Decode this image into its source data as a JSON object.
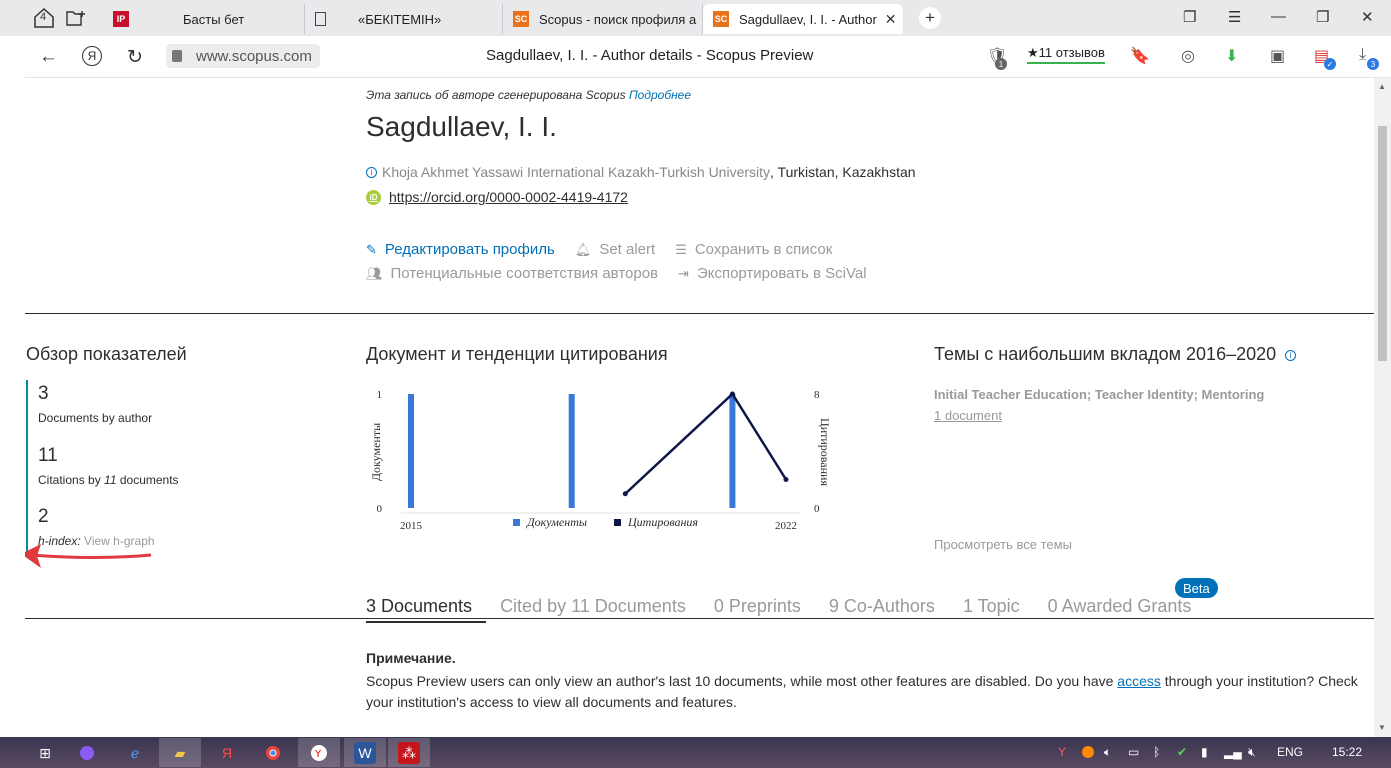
{
  "browser": {
    "tabs": [
      {
        "label": "",
        "icon": "tabs-count-icon"
      },
      {
        "label": "Басты бет",
        "icon": "ip-favicon"
      },
      {
        "label": "«БЕКІТЕМІН»",
        "icon": "document-favicon"
      },
      {
        "label": "Scopus - поиск профиля а",
        "icon": "scopus-favicon"
      },
      {
        "label": "Sagdullaev, I. I. - Author",
        "icon": "scopus-favicon",
        "active": true
      }
    ],
    "tabs_counter": "4",
    "url": "www.scopus.com",
    "page_title": "Sagdullaev, I. I. - Author details - Scopus Preview",
    "reviews_label": "★11 отзывов",
    "favicon_text": "SC",
    "badge_1": "1",
    "badge_3": "3"
  },
  "author": {
    "generated_note": "Эта запись об авторе сгенерирована Scopus",
    "generated_link": "Подробнее",
    "name": "Sagdullaev, I. I.",
    "affiliation": "Khoja Akhmet Yassawi International Kazakh-Turkish University",
    "location": ", Turkistan, Kazakhstan",
    "orcid": "https://orcid.org/0000-0002-4419-4172",
    "orcid_icon_text": "iD"
  },
  "actions": {
    "edit_profile": "Редактировать профиль",
    "set_alert": "Set alert",
    "save_to_list": "Сохранить в список",
    "potential_matches": "Потенциальные соответствия авторов",
    "export_scival": "Экспортировать в SciVal"
  },
  "metrics": {
    "title": "Обзор показателей",
    "documents_value": "3",
    "documents_label": "Documents by author",
    "citations_value": "11",
    "citations_label_pre": "Citations by",
    "citations_label_num": "11",
    "citations_label_post": "documents",
    "hindex_value": "2",
    "hindex_label": "h-index:",
    "hindex_link": "View h-graph"
  },
  "chart_section": {
    "title": "Документ и тенденции цитирования"
  },
  "chart_data": {
    "type": "bar",
    "x_start": 2015,
    "x_end": 2022,
    "x_tick_labels": [
      "2015",
      "2022"
    ],
    "series": [
      {
        "name": "Документы",
        "type": "bar",
        "axis": "left",
        "color": "#3a78d8",
        "points": [
          {
            "x": 2015,
            "y": 1
          },
          {
            "x": 2018,
            "y": 1
          },
          {
            "x": 2021,
            "y": 1
          }
        ]
      },
      {
        "name": "Цитирования",
        "type": "line",
        "axis": "right",
        "color": "#0f1747",
        "points": [
          {
            "x": 2019,
            "y": 1
          },
          {
            "x": 2021,
            "y": 8
          },
          {
            "x": 2022,
            "y": 2
          }
        ]
      }
    ],
    "ylabel_left": "Документы",
    "ylabel_right": "Цитирования",
    "ylim_left": [
      0,
      1
    ],
    "ylim_right": [
      0,
      8
    ],
    "y_left_ticks": [
      "0",
      "1"
    ],
    "y_right_ticks": [
      "0",
      "8"
    ],
    "legend_position": "bottom"
  },
  "topics": {
    "title": "Темы с наибольшим вкладом 2016–2020",
    "info_icon": "i",
    "topic_name": "Initial Teacher Education; Teacher Identity; Mentoring",
    "topic_docs": "1 document",
    "view_all": "Просмотреть все темы"
  },
  "doc_tabs": {
    "documents": "3 Documents",
    "cited_by": "Cited by 11 Documents",
    "preprints": "0 Preprints",
    "coauthors": "9 Co-Authors",
    "topic": "1 Topic",
    "grants": "0 Awarded Grants",
    "beta": "Beta"
  },
  "note": {
    "title": "Примечание.",
    "text_pre": "Scopus Preview users can only view an author's last 10 documents, while most other features are disabled. Do you have",
    "link": "access",
    "text_post": "through your institution? Check your institution's access to view all documents and features."
  },
  "taskbar": {
    "lang": "ENG",
    "time": "15:22"
  },
  "colors": {
    "scopus_blue": "#0070b8",
    "teal_accent": "#0a8a9c",
    "annotation_red": "#e03a3e",
    "orcid_green": "#a6ce39"
  }
}
